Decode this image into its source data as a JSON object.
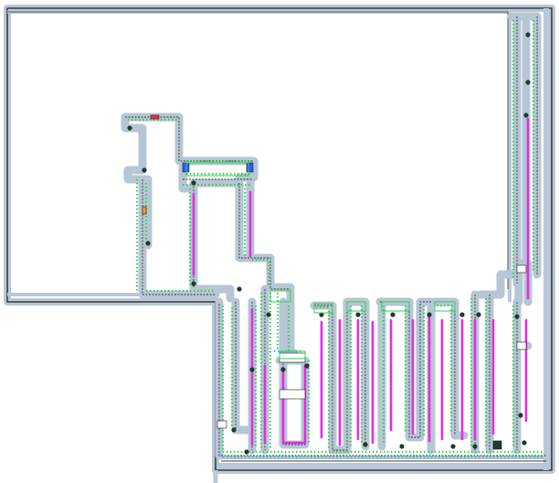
{
  "map": {
    "kind": "floor plan with conveyor / robot path network",
    "colors": {
      "background": "#ffffff",
      "wall_outline": "#8fa3b7",
      "wall_core": "#3a3a3a",
      "path_halo": "#b7c6d5",
      "route_highlight": "#e22ee0",
      "node_fill": "#1f3a2a",
      "tick_green": "#2fd14b",
      "tick_blue": "#2a5bff",
      "tick_red": "#ff2a2a",
      "tick_cyan": "#24d0d8"
    },
    "legend": []
  }
}
